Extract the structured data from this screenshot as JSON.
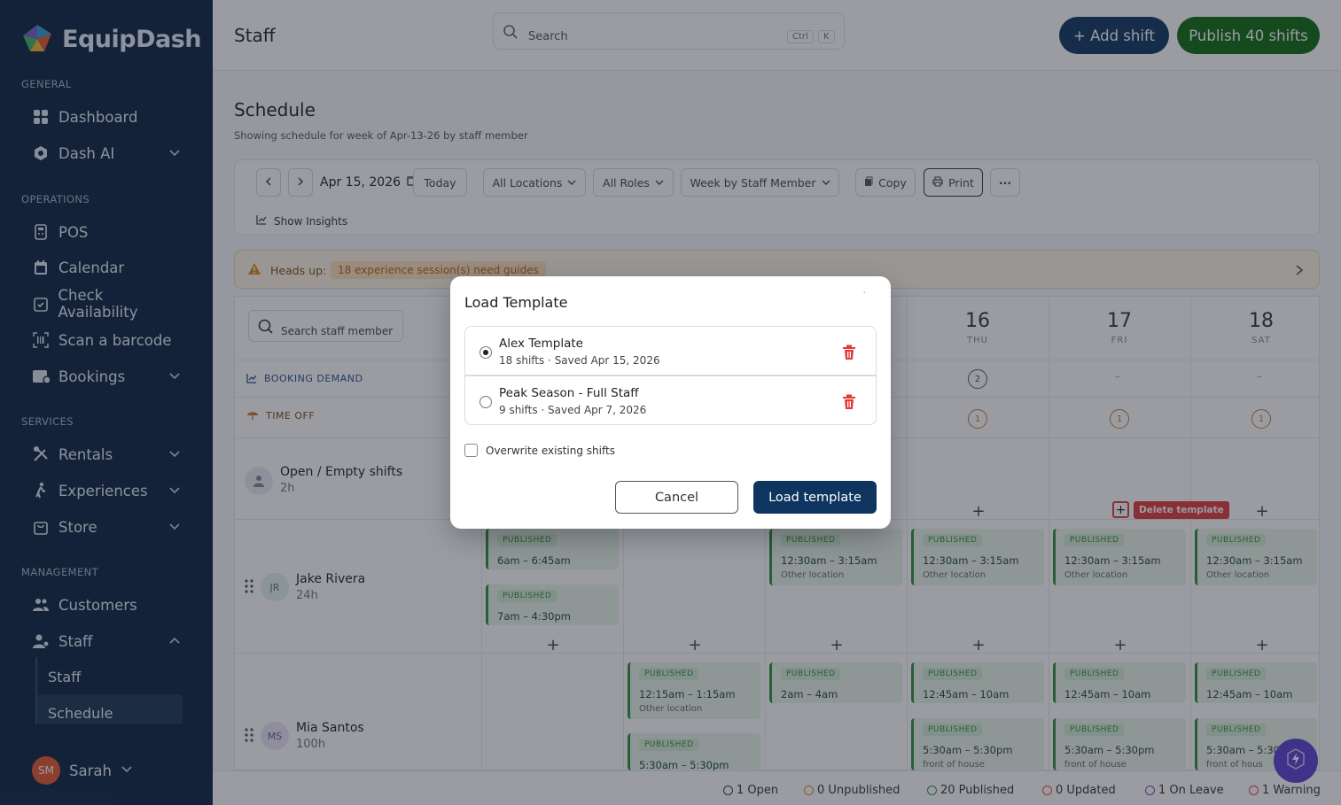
{
  "app": {
    "name": "EquipDash",
    "colors": {
      "navy": "#0b2240",
      "accent": "#0e3460",
      "publish": "#0d6b12",
      "danger": "#e23a3a",
      "warning": "#c77b2b"
    }
  },
  "sidebar": {
    "sections": {
      "general": "GENERAL",
      "operations": "OPERATIONS",
      "services": "SERVICES",
      "management": "MANAGEMENT"
    },
    "items": {
      "dashboard": {
        "label": "Dashboard",
        "icon": "grid-icon"
      },
      "dash_ai": {
        "label": "Dash AI",
        "icon": "shield-icon"
      },
      "pos": {
        "label": "POS",
        "icon": "pos-icon"
      },
      "calendar": {
        "label": "Calendar",
        "icon": "calendar-icon"
      },
      "check_availability": {
        "label": "Check Availability",
        "icon": "calendar-check-icon"
      },
      "scan_barcode": {
        "label": "Scan a barcode",
        "icon": "barcode-icon"
      },
      "bookings": {
        "label": "Bookings",
        "icon": "bookings-icon"
      },
      "rentals": {
        "label": "Rentals",
        "icon": "rentals-icon"
      },
      "experiences": {
        "label": "Experiences",
        "icon": "hiker-icon"
      },
      "store": {
        "label": "Store",
        "icon": "bag-icon"
      },
      "customers": {
        "label": "Customers",
        "icon": "users-icon"
      },
      "staff": {
        "label": "Staff",
        "icon": "staff-icon"
      }
    },
    "staff_sub": {
      "staff": "Staff",
      "schedule": "Schedule"
    },
    "user": {
      "initials": "SM",
      "name": "Sarah"
    }
  },
  "header": {
    "title": "Staff",
    "search_placeholder": "Search",
    "shortcut_ctrl": "Ctrl",
    "shortcut_key": "K",
    "add_shift": "+ Add shift",
    "publish": "Publish 40 shifts"
  },
  "schedule": {
    "title": "Schedule",
    "subtitle": "Showing schedule for week of Apr-13-26 by staff member",
    "toolbar": {
      "date": "Apr 15, 2026",
      "today": "Today",
      "locations": "All Locations",
      "roles": "All Roles",
      "view": "Week by Staff Member",
      "copy": "Copy",
      "print": "Print",
      "more": "···",
      "insights": "Show Insights"
    },
    "alert": {
      "label": "Heads up:",
      "message": "18 experience session(s) need guides"
    },
    "search_staff_placeholder": "Search staff member",
    "rows": {
      "booking_demand": "BOOKING DEMAND",
      "time_off": "TIME OFF"
    },
    "days": [
      {
        "num": "16",
        "wd": "THU"
      },
      {
        "num": "17",
        "wd": "FRI"
      },
      {
        "num": "18",
        "wd": "SAT"
      }
    ],
    "demand_count": "2",
    "timeoff_count": "1",
    "demand_empty": "–",
    "open_shifts": {
      "label": "Open / Empty shifts",
      "hours": "2h"
    },
    "staff": [
      {
        "initials": "JR",
        "name": "Jake Rivera",
        "hours": "24h"
      },
      {
        "initials": "MS",
        "name": "Mia Santos",
        "hours": "100h"
      }
    ],
    "shift_tag": "PUBLISHED",
    "shifts": {
      "a": "6am – 6:45am",
      "b": "7am – 4:30pm",
      "c": "12:30am – 3:15am",
      "d": "12:15am – 1:15am",
      "e": "2am – 4am",
      "f": "12:45am – 10am",
      "g": "5:30am – 5:30pm",
      "h": "5:30am – 5:30",
      "other": "Other location",
      "front": "front of house",
      "front_short": "front of hous"
    },
    "plus": "+",
    "tooltip": "Delete template"
  },
  "modal": {
    "title": "Load Template",
    "close": "·",
    "options": [
      {
        "name": "Alex Template",
        "meta": "18 shifts · Saved Apr 15, 2026",
        "selected": true
      },
      {
        "name": "Peak Season - Full Staff",
        "meta": "9 shifts · Saved Apr 7, 2026",
        "selected": false
      }
    ],
    "overwrite": "Overwrite existing shifts",
    "cancel": "Cancel",
    "load": "Load template"
  },
  "status": {
    "open": "1 Open",
    "unpublished": "0 Unpublished",
    "published": "20 Published",
    "updated": "0 Updated",
    "leave": "1 On Leave",
    "warning": "1 Warning"
  }
}
